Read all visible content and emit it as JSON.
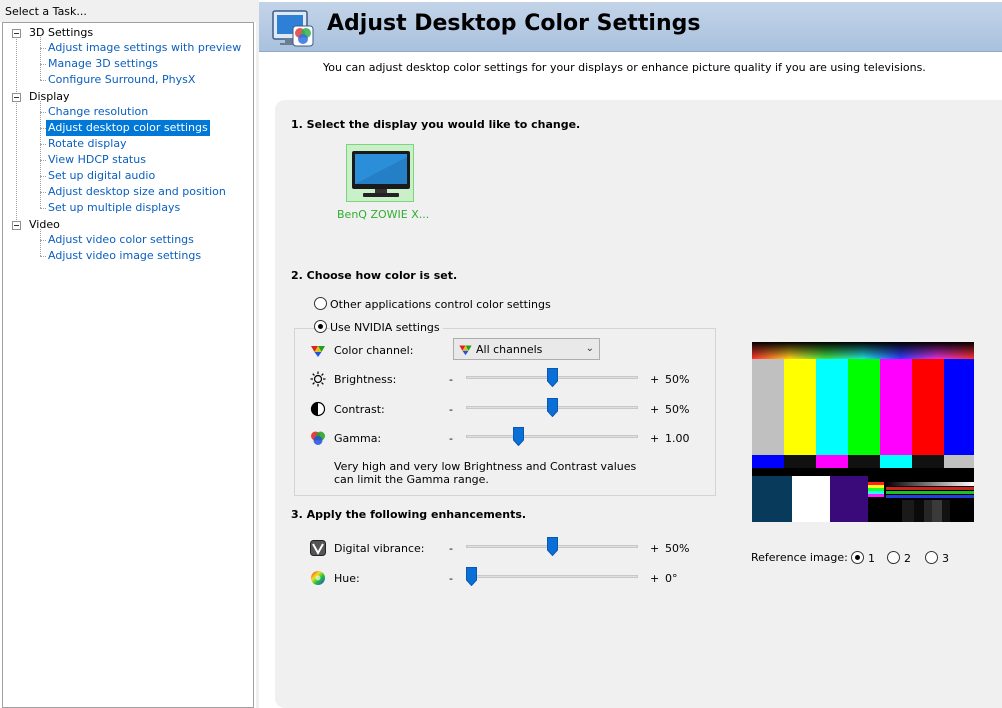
{
  "left_panel": {
    "header": "Select a Task...",
    "categories": [
      {
        "label": "3D Settings",
        "items": [
          "Adjust image settings with preview",
          "Manage 3D settings",
          "Configure Surround, PhysX"
        ]
      },
      {
        "label": "Display",
        "items": [
          "Change resolution",
          "Adjust desktop color settings",
          "Rotate display",
          "View HDCP status",
          "Set up digital audio",
          "Adjust desktop size and position",
          "Set up multiple displays"
        ]
      },
      {
        "label": "Video",
        "items": [
          "Adjust video color settings",
          "Adjust video image settings"
        ]
      }
    ],
    "selected_item": "Adjust desktop color settings"
  },
  "page": {
    "title": "Adjust Desktop Color Settings",
    "subtitle": "You can adjust desktop color settings for your displays or enhance picture quality if you are using televisions."
  },
  "section1": {
    "title": "1. Select the display you would like to change.",
    "display_name": "BenQ ZOWIE X..."
  },
  "section2": {
    "title": "2. Choose how color is set.",
    "option_other": "Other applications control color settings",
    "option_nvidia": "Use NVIDIA settings",
    "selected_option": "Use NVIDIA settings",
    "color_channel_label": "Color channel:",
    "color_channel_value": "All channels",
    "brightness": {
      "label": "Brightness:",
      "minus": "-",
      "plus": "+",
      "value": "50%",
      "level": 0.5
    },
    "contrast": {
      "label": "Contrast:",
      "minus": "-",
      "plus": "+",
      "value": "50%",
      "level": 0.5
    },
    "gamma": {
      "label": "Gamma:",
      "minus": "-",
      "plus": "+",
      "value": "1.00",
      "level": 0.29
    },
    "note": "Very high and very low Brightness and Contrast values can limit the Gamma range."
  },
  "section3": {
    "title": "3. Apply the following enhancements.",
    "vibrance": {
      "label": "Digital vibrance:",
      "minus": "-",
      "plus": "+",
      "value": "50%",
      "level": 0.5
    },
    "hue": {
      "label": "Hue:",
      "minus": "-",
      "plus": "+",
      "value": "0°",
      "level": 0.0
    }
  },
  "reference": {
    "label": "Reference image:",
    "options": [
      "1",
      "2",
      "3"
    ],
    "selected": "1"
  },
  "colors": {
    "accent_selected": "#0078d7",
    "link_blue": "#0a5fbf",
    "slider_thumb": "#0a6fd6",
    "display_green": "#2fae2f"
  }
}
